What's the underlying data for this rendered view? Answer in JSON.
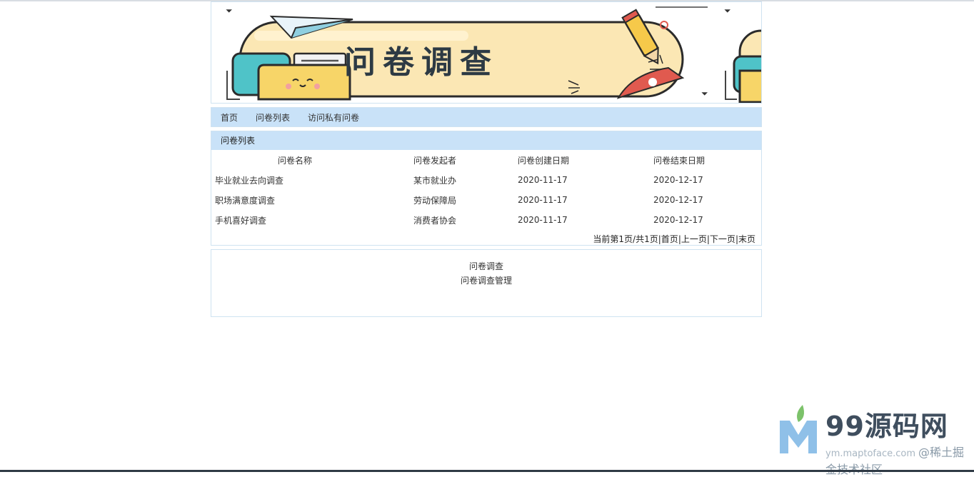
{
  "banner": {
    "title": "问卷调查"
  },
  "nav": {
    "items": [
      {
        "label": "首页"
      },
      {
        "label": "问卷列表"
      },
      {
        "label": "访问私有问卷"
      }
    ]
  },
  "survey_panel": {
    "title": "问卷列表",
    "columns": [
      "问卷名称",
      "问卷发起者",
      "问卷创建日期",
      "问卷结束日期"
    ],
    "rows": [
      {
        "name": "毕业就业去向调查",
        "org": "某市就业办",
        "start": "2020-11-17",
        "end": "2020-12-17"
      },
      {
        "name": "职场满意度调查",
        "org": "劳动保障局",
        "start": "2020-11-17",
        "end": "2020-12-17"
      },
      {
        "name": "手机喜好调查",
        "org": "消费者协会",
        "start": "2020-11-17",
        "end": "2020-12-17"
      }
    ],
    "pager": {
      "status": "当前第1页/共1页",
      "first": "首页",
      "prev": "上一页",
      "next": "下一页",
      "last": "末页",
      "sep": "|"
    }
  },
  "footer": {
    "line1": "问卷调查",
    "line2": "问卷调查管理"
  },
  "watermark": {
    "brand": "99源码网",
    "url": "ym.maptoface.com",
    "community": "@稀土掘金技术社区"
  },
  "colors": {
    "nav_bg": "#c9e2f8",
    "border": "#cfe3f1",
    "banner_yellow": "#fbe7b4",
    "banner_text": "#2d3a44"
  }
}
